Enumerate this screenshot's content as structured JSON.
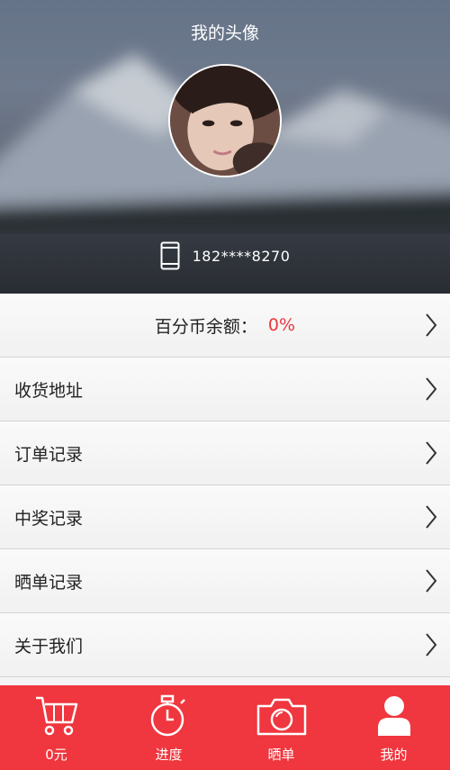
{
  "header": {
    "title": "我的头像",
    "phone": "182****8270"
  },
  "balance": {
    "label": "百分币余额：",
    "value": "0%",
    "value_color": "#e8383d"
  },
  "menu": {
    "items": [
      {
        "label": "收货地址"
      },
      {
        "label": "订单记录"
      },
      {
        "label": "中奖记录"
      },
      {
        "label": "晒单记录"
      },
      {
        "label": "关于我们"
      }
    ]
  },
  "tabbar": {
    "background": "#f0363e",
    "tabs": [
      {
        "label": "0元",
        "icon": "cart-icon"
      },
      {
        "label": "进度",
        "icon": "stopwatch-icon"
      },
      {
        "label": "晒单",
        "icon": "camera-icon"
      },
      {
        "label": "我的",
        "icon": "user-icon"
      }
    ]
  }
}
